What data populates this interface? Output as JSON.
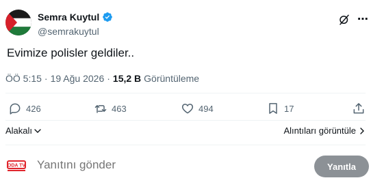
{
  "author": {
    "display_name": "Semra Kuytul",
    "handle": "@semrakuytul",
    "avatar_icon": "palestine-flag-avatar",
    "verified_icon": "verified-badge-icon"
  },
  "tweet": {
    "text": "Evimize polisler geldiler.."
  },
  "meta": {
    "time": "ÖÖ 5:15",
    "separator": "·",
    "date": "19 Ağu 2026",
    "views_count": "15,2 B",
    "views_label": "Görüntüleme"
  },
  "actions": {
    "replies": "426",
    "reposts": "463",
    "likes": "494",
    "bookmarks": "17"
  },
  "links": {
    "related": "Alakalı",
    "quotes": "Alıntıları görüntüle"
  },
  "reply": {
    "placeholder": "Yanıtını gönder",
    "button_label": "Yanıtla",
    "avatar_text": "ODA TV"
  },
  "colors": {
    "secondary_text": "#536471",
    "primary_text": "#0f1419",
    "verified": "#1d9bf0",
    "button_disabled": "#8c9196"
  }
}
